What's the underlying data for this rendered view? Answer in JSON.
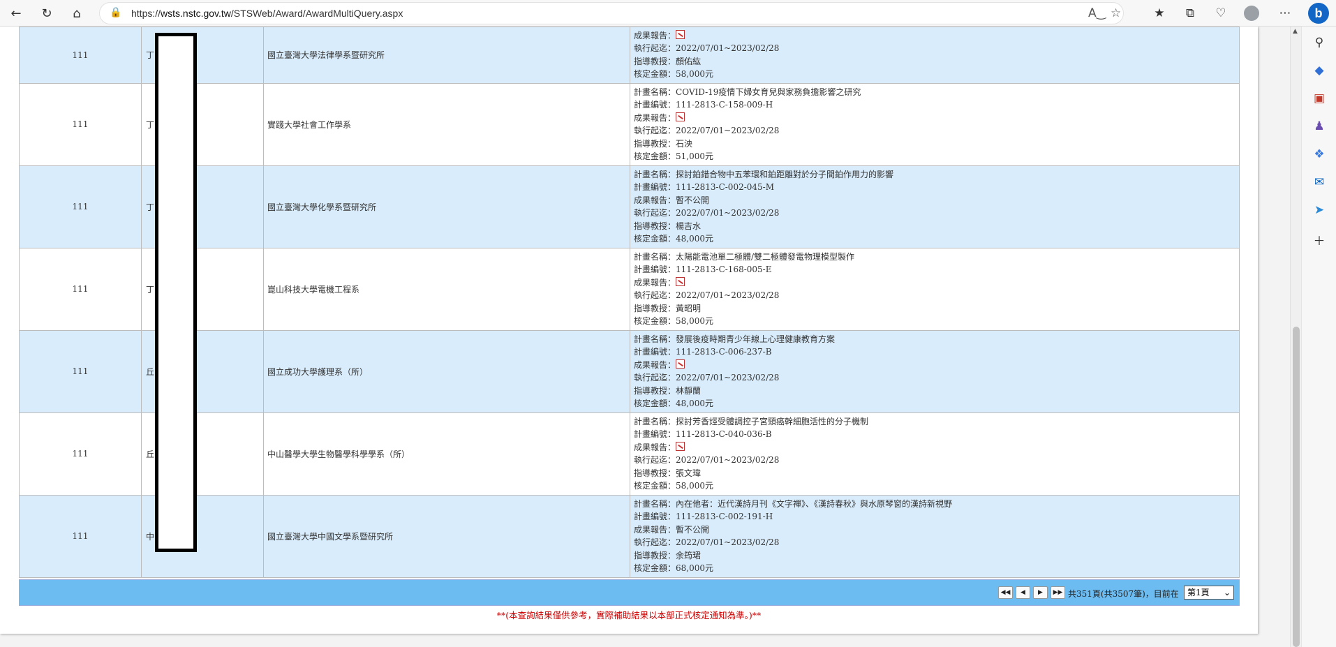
{
  "browser": {
    "url_prefix": "https://",
    "url_domain": "wsts.nstc.gov.tw",
    "url_path": "/STSWeb/Award/AwardMultiQuery.aspx"
  },
  "labels": {
    "plan_name": "計畫名稱：",
    "plan_no": "計畫編號：",
    "report": "成果報告：",
    "period": "執行起迄：",
    "advisor": "指導教授：",
    "amount": "核定金額："
  },
  "rows": [
    {
      "year": "111",
      "name": "丁",
      "school": "國立臺灣大學法律學系暨研究所",
      "plan_name": "",
      "plan_no": "",
      "report": "",
      "period": "2022/07/01~2023/02/28",
      "advisor": "顏佑紘",
      "amount": "58,000元"
    },
    {
      "year": "111",
      "name": "丁",
      "school": "實踐大學社會工作學系",
      "plan_name": "COVID-19疫情下婦女育兒與家務負擔影響之研究",
      "plan_no": "111-2813-C-158-009-H",
      "report": "",
      "period": "2022/07/01~2023/02/28",
      "advisor": "石泱",
      "amount": "51,000元"
    },
    {
      "year": "111",
      "name": "丁",
      "school": "國立臺灣大學化學系暨研究所",
      "plan_name": "探討鉑錯合物中五苯環和鉑距離對於分子間鉑作用力的影響",
      "plan_no": "111-2813-C-002-045-M",
      "report": "暫不公開",
      "period": "2022/07/01~2023/02/28",
      "advisor": "楊吉水",
      "amount": "48,000元"
    },
    {
      "year": "111",
      "name": "丁",
      "school": "崑山科技大學電機工程系",
      "plan_name": "太陽能電池單二極體/雙二極體發電物理模型製作",
      "plan_no": "111-2813-C-168-005-E",
      "report": "",
      "period": "2022/07/01~2023/02/28",
      "advisor": "黃昭明",
      "amount": "58,000元"
    },
    {
      "year": "111",
      "name": "丘",
      "school": "國立成功大學護理系（所）",
      "plan_name": "發展後疫時期青少年線上心理健康教育方案",
      "plan_no": "111-2813-C-006-237-B",
      "report": "",
      "period": "2022/07/01~2023/02/28",
      "advisor": "林靜蘭",
      "amount": "48,000元"
    },
    {
      "year": "111",
      "name": "丘",
      "school": "中山醫學大學生物醫學科學學系（所）",
      "plan_name": "探討芳香烴受體調控子宮頸癌幹細胞活性的分子機制",
      "plan_no": "111-2813-C-040-036-B",
      "report": "",
      "period": "2022/07/01~2023/02/28",
      "advisor": "張文瑋",
      "amount": "58,000元"
    },
    {
      "year": "111",
      "name": "中",
      "school": "國立臺灣大學中國文學系暨研究所",
      "plan_name": "內在他者：近代漢詩月刊《文字禪》、《漢詩春秋》與水原琴窗的漢詩新視野",
      "plan_no": "111-2813-C-002-191-H",
      "report": "暫不公開",
      "period": "2022/07/01~2023/02/28",
      "advisor": "余筠珺",
      "amount": "68,000元"
    }
  ],
  "pager": {
    "summary": "共351頁(共3507筆)，目前在",
    "current": "第1頁"
  },
  "notice": "**(本查詢結果僅供參考，實際補助結果以本部正式核定通知為準。)**"
}
